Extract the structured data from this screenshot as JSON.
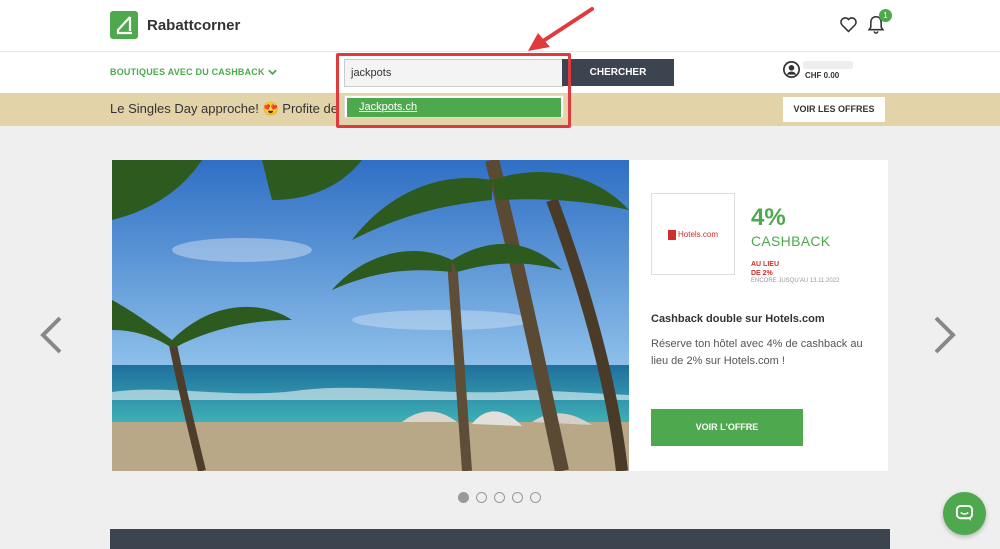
{
  "header": {
    "logo_text": "Rabattcorner",
    "notifications_count": "1",
    "icons": [
      "logo-icon",
      "heart-icon",
      "bell-icon"
    ]
  },
  "nav": {
    "shops_label": "BOUTIQUES AVEC DU CASHBACK",
    "search_value": "jackpots",
    "search_button": "CHERCHER",
    "account_balance": "CHF 0.00"
  },
  "search_dropdown": {
    "items": [
      {
        "label": "Jackpots.ch"
      }
    ]
  },
  "promo": {
    "text": "Le Singles Day approche! 😍 Profite de",
    "button": "VOIR LES OFFRES"
  },
  "hero": {
    "partner_name": "Hotels.com",
    "cashback_percent": "4%",
    "cashback_label": "CASHBACK",
    "instead_line1": "AU LIEU",
    "instead_line2": "DE 2%",
    "valid_until": "ENCORE JUSQU'AU 13.11.2022",
    "title": "Cashback double sur Hotels.com",
    "description": "Réserve ton hôtel avec 4% de cashback au lieu de 2% sur Hotels.com !",
    "cta": "VOIR L'OFFRE"
  },
  "carousel": {
    "slide_count": 5,
    "active_index": 0
  },
  "colors": {
    "brand_green": "#4ea84e",
    "dark": "#3c4450",
    "promo_bg": "#e2d3a8",
    "highlight_red": "#e0393e"
  }
}
